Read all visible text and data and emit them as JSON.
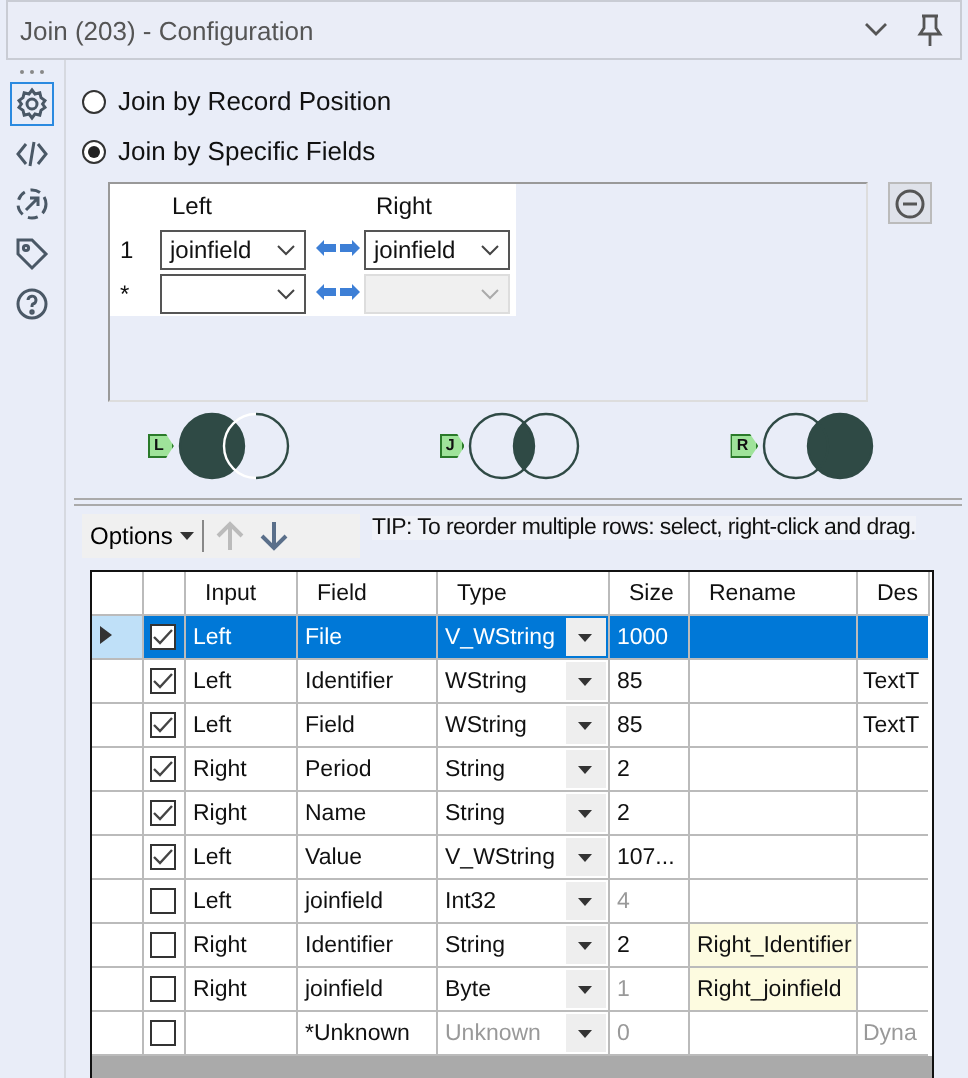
{
  "window": {
    "title": "Join (203) - Configuration"
  },
  "sidebar": {
    "items": [
      {
        "kind": "gear",
        "selected": true
      },
      {
        "kind": "code",
        "selected": false
      },
      {
        "kind": "connect",
        "selected": false
      },
      {
        "kind": "tag",
        "selected": false
      },
      {
        "kind": "help",
        "selected": false
      }
    ]
  },
  "join_mode": [
    {
      "label": "Join by Record Position",
      "selected": false
    },
    {
      "label": "Join by Specific Fields",
      "selected": true
    }
  ],
  "join_fields": {
    "columns": [
      "Left",
      "Right"
    ],
    "rows": [
      {
        "marker": "1",
        "left": "joinfield",
        "right": "joinfield",
        "right_disabled": false
      },
      {
        "marker": "*",
        "right_disabled": true
      }
    ]
  },
  "join_outputs": [
    {
      "tag": "L",
      "kind": "left"
    },
    {
      "tag": "J",
      "kind": "inner"
    },
    {
      "tag": "R",
      "kind": "right"
    }
  ],
  "toolbar": {
    "options": "Options",
    "up_disabled": true,
    "down_disabled": false,
    "tip": "TIP: To reorder multiple rows: select, right-click and drag."
  },
  "table": {
    "columns": [
      "Input",
      "Field",
      "Type",
      "Size",
      "Rename",
      "Des"
    ],
    "rows": [
      {
        "selected": true,
        "checked": true,
        "input": "Left",
        "field": "File",
        "type": "V_WString",
        "size": "1000"
      },
      {
        "selected": false,
        "checked": true,
        "input": "Left",
        "field": "Identifier",
        "type": "WString",
        "size": "85",
        "description": "TextT"
      },
      {
        "selected": false,
        "checked": true,
        "input": "Left",
        "field": "Field",
        "type": "WString",
        "size": "85",
        "description": "TextT"
      },
      {
        "selected": false,
        "checked": true,
        "input": "Right",
        "field": "Period",
        "type": "String",
        "size": "2"
      },
      {
        "selected": false,
        "checked": true,
        "input": "Right",
        "field": "Name",
        "type": "String",
        "size": "2"
      },
      {
        "selected": false,
        "checked": true,
        "input": "Left",
        "field": "Value",
        "type": "V_WString",
        "size": "107..."
      },
      {
        "selected": false,
        "checked": false,
        "input": "Left",
        "field": "joinfield",
        "type": "Int32",
        "size": "4",
        "size_dim": true
      },
      {
        "selected": false,
        "checked": false,
        "input": "Right",
        "field": "Identifier",
        "type": "String",
        "size": "2",
        "rename": "Right_Identifier"
      },
      {
        "selected": false,
        "checked": false,
        "input": "Right",
        "field": "joinfield",
        "type": "Byte",
        "size": "1",
        "size_dim": true,
        "rename": "Right_joinfield"
      },
      {
        "selected": false,
        "checked": false,
        "field": "*Unknown",
        "type": "Unknown",
        "type_dim": true,
        "size": "0",
        "size_dim": true,
        "description": "Dyna"
      }
    ]
  }
}
